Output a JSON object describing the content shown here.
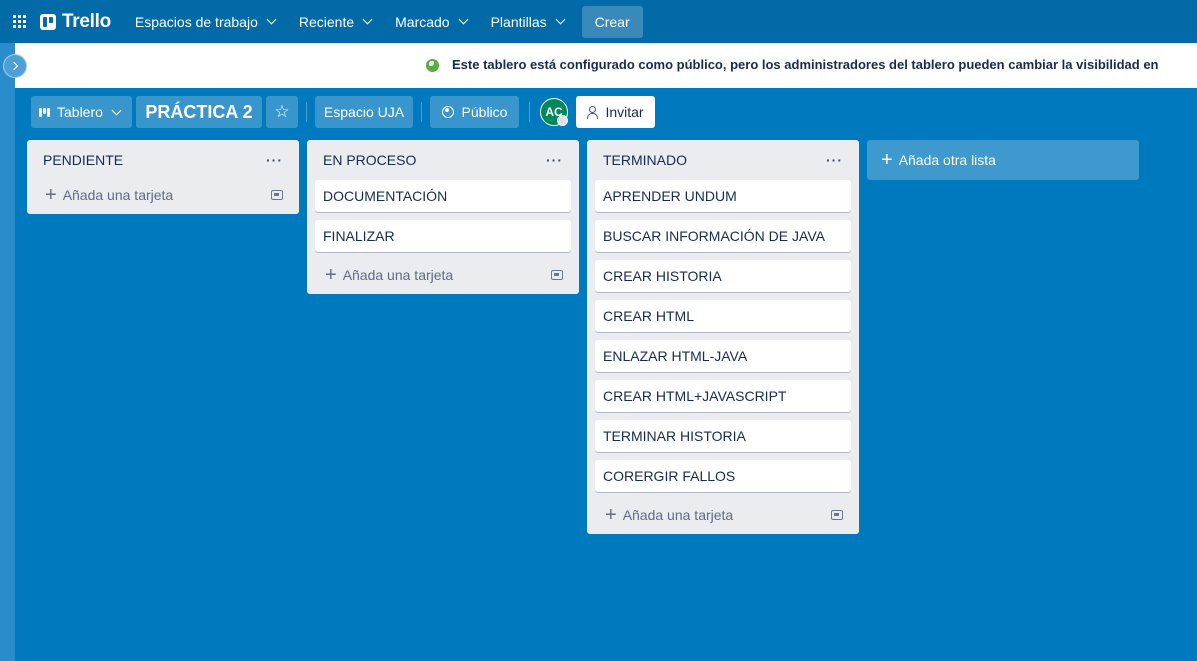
{
  "nav": {
    "logo_text": "Trello",
    "items": [
      {
        "label": "Espacios de trabajo"
      },
      {
        "label": "Reciente"
      },
      {
        "label": "Marcado"
      },
      {
        "label": "Plantillas"
      }
    ],
    "create_label": "Crear"
  },
  "banner": {
    "text": "Este tablero está configurado como público, pero los administradores del tablero pueden cambiar la visibilidad en"
  },
  "board": {
    "view_label": "Tablero",
    "title": "PRÁCTICA 2",
    "star_icon": "☆",
    "workspace_label": "Espacio UJA",
    "visibility_label": "Público",
    "member_initials": "AC",
    "invite_label": "Invitar"
  },
  "lists": [
    {
      "title": "PENDIENTE",
      "cards": [],
      "add_card_label": "Añada una tarjeta"
    },
    {
      "title": "EN PROCESO",
      "cards": [
        "DOCUMENTACIÓN",
        "FINALIZAR"
      ],
      "add_card_label": "Añada una tarjeta"
    },
    {
      "title": "TERMINADO",
      "cards": [
        "APRENDER UNDUM",
        "BUSCAR INFORMACIÓN DE JAVA",
        "CREAR HISTORIA",
        "CREAR HTML",
        "ENLAZAR HTML-JAVA",
        "CREAR HTML+JAVASCRIPT",
        "TERMINAR HISTORIA",
        "CORERGIR FALLOS"
      ],
      "add_card_label": "Añada una tarjeta"
    }
  ],
  "add_list_label": "Añada otra lista",
  "colors": {
    "board_bg": "#0079bf",
    "nav_bg": "#026aa7",
    "list_bg": "#ebecf0"
  }
}
